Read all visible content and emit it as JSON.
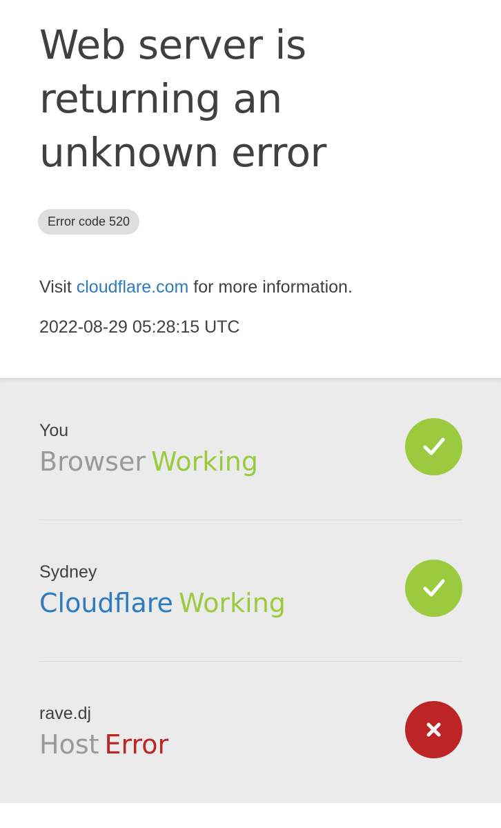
{
  "header": {
    "title": "Web server is returning an unknown error",
    "error_badge": "Error code 520",
    "visit_prefix": "Visit ",
    "visit_link": "cloudflare.com",
    "visit_suffix": " for more information.",
    "timestamp": "2022-08-29 05:28:15 UTC"
  },
  "status": [
    {
      "location": "You",
      "node": "Browser",
      "state": "Working",
      "icon": "check-icon"
    },
    {
      "location": "Sydney",
      "node": "Cloudflare",
      "state": "Working",
      "icon": "check-icon"
    },
    {
      "location": "rave.dj",
      "node": "Host",
      "state": "Error",
      "icon": "close-icon"
    }
  ],
  "colors": {
    "working": "#9bca3e",
    "error": "#bd2426",
    "link": "#2f7bbf",
    "node_gray": "#999999"
  }
}
